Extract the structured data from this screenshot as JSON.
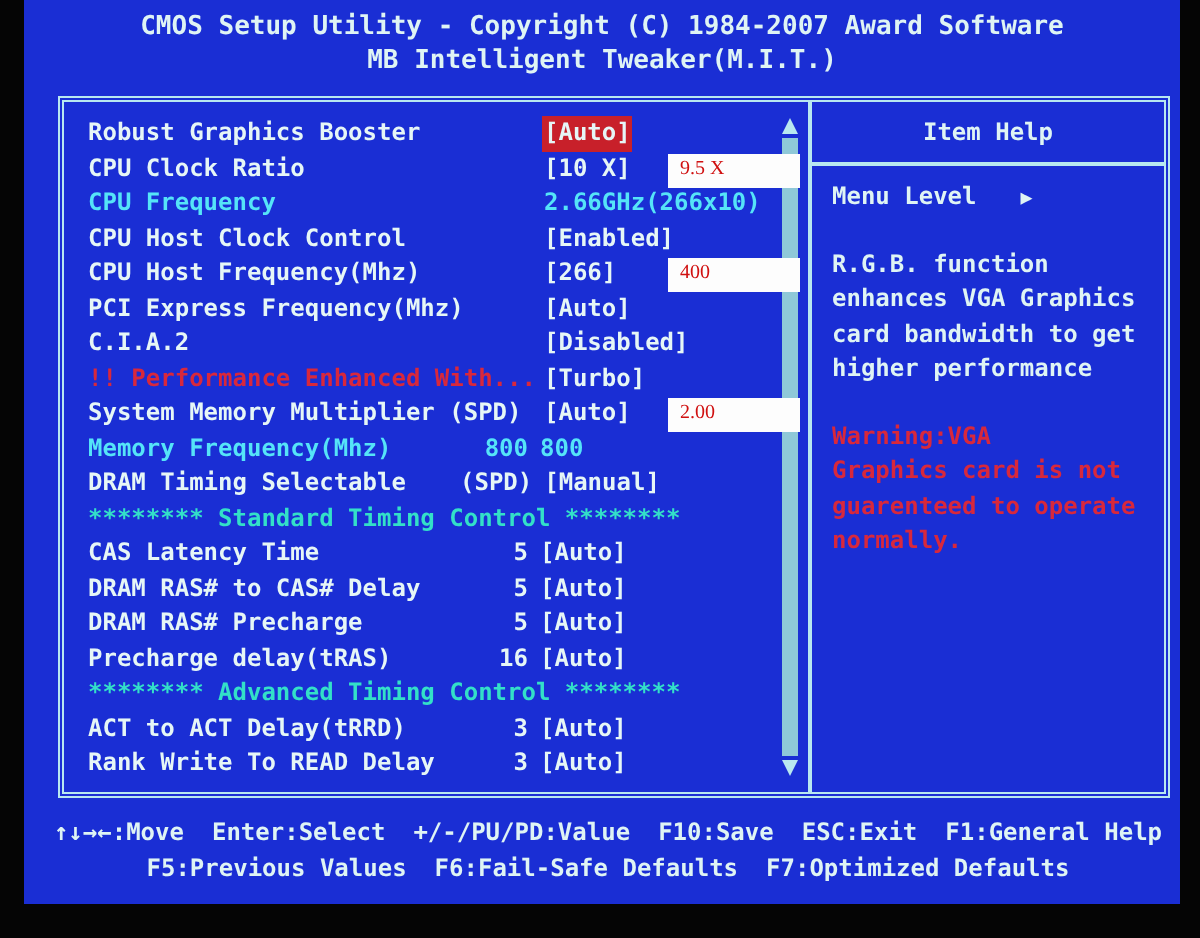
{
  "title": "CMOS Setup Utility - Copyright (C) 1984-2007 Award Software",
  "subtitle": "MB Intelligent Tweaker(M.I.T.)",
  "settings": [
    {
      "kind": "setting",
      "label": "Robust Graphics Booster",
      "value": "[Auto]",
      "selected": true
    },
    {
      "kind": "setting",
      "label": "CPU Clock Ratio",
      "value": "[10 X]",
      "selected": false,
      "note": "9.5 X"
    },
    {
      "kind": "info",
      "label": "CPU Frequency",
      "value": "2.66GHz(266x10)",
      "selected": false
    },
    {
      "kind": "setting",
      "label": "CPU Host Clock Control",
      "value": "[Enabled]",
      "selected": false
    },
    {
      "kind": "setting",
      "label": "CPU Host Frequency(Mhz)",
      "value": "[266]",
      "selected": false,
      "note": "400"
    },
    {
      "kind": "setting",
      "label": "PCI Express Frequency(Mhz)",
      "value": "[Auto]",
      "selected": false
    },
    {
      "kind": "setting",
      "label": "C.I.A.2",
      "value": "[Disabled]",
      "selected": false
    },
    {
      "kind": "warning",
      "label": "!! Performance Enhanced With...",
      "value": "[Turbo]",
      "selected": false
    },
    {
      "kind": "setting",
      "label": "System Memory Multiplier (SPD)",
      "value": "[Auto]",
      "selected": false,
      "note": "2.00"
    },
    {
      "kind": "info",
      "label": "Memory Frequency(Mhz)",
      "column_2": "800",
      "value": "800",
      "selected": false
    },
    {
      "kind": "setting",
      "label": "DRAM Timing Selectable",
      "column_2": "(SPD)",
      "value": "[Manual]",
      "selected": false
    },
    {
      "kind": "header",
      "label": "******** Standard Timing Control ********"
    },
    {
      "kind": "setting",
      "label": "CAS Latency Time",
      "column_2": "5",
      "value": "[Auto]",
      "selected": false
    },
    {
      "kind": "setting",
      "label": "DRAM RAS# to CAS# Delay",
      "column_2": "5",
      "value": "[Auto]",
      "selected": false
    },
    {
      "kind": "setting",
      "label": "DRAM RAS# Precharge",
      "column_2": "5",
      "value": "[Auto]",
      "selected": false
    },
    {
      "kind": "setting",
      "label": "Precharge delay(tRAS)",
      "column_2": "16",
      "value": "[Auto]",
      "selected": false
    },
    {
      "kind": "header",
      "label": "******** Advanced Timing Control ********"
    },
    {
      "kind": "setting",
      "label": "ACT to ACT Delay(tRRD)",
      "column_2": "3",
      "value": "[Auto]",
      "selected": false
    },
    {
      "kind": "setting",
      "label": "Rank Write To READ Delay",
      "column_2": "3",
      "value": "[Auto]",
      "selected": false
    }
  ],
  "item_help": {
    "title": "Item Help",
    "menu_level": "Menu Level",
    "menu_level_arrow": "▶",
    "text": [
      "R.G.B. function",
      "enhances VGA Graphics",
      "card bandwidth to get",
      "higher performance"
    ],
    "warning": [
      "Warning:VGA",
      "Graphics card is not",
      "guarenteed to operate",
      "normally."
    ]
  },
  "footer": [
    [
      "↑↓→←:Move",
      "Enter:Select",
      "+/-/PU/PD:Value",
      "F10:Save",
      "ESC:Exit",
      "F1:General Help"
    ],
    [
      "F5:Previous Values",
      "F6:Fail-Safe Defaults",
      "F7:Optimized Defaults"
    ]
  ]
}
